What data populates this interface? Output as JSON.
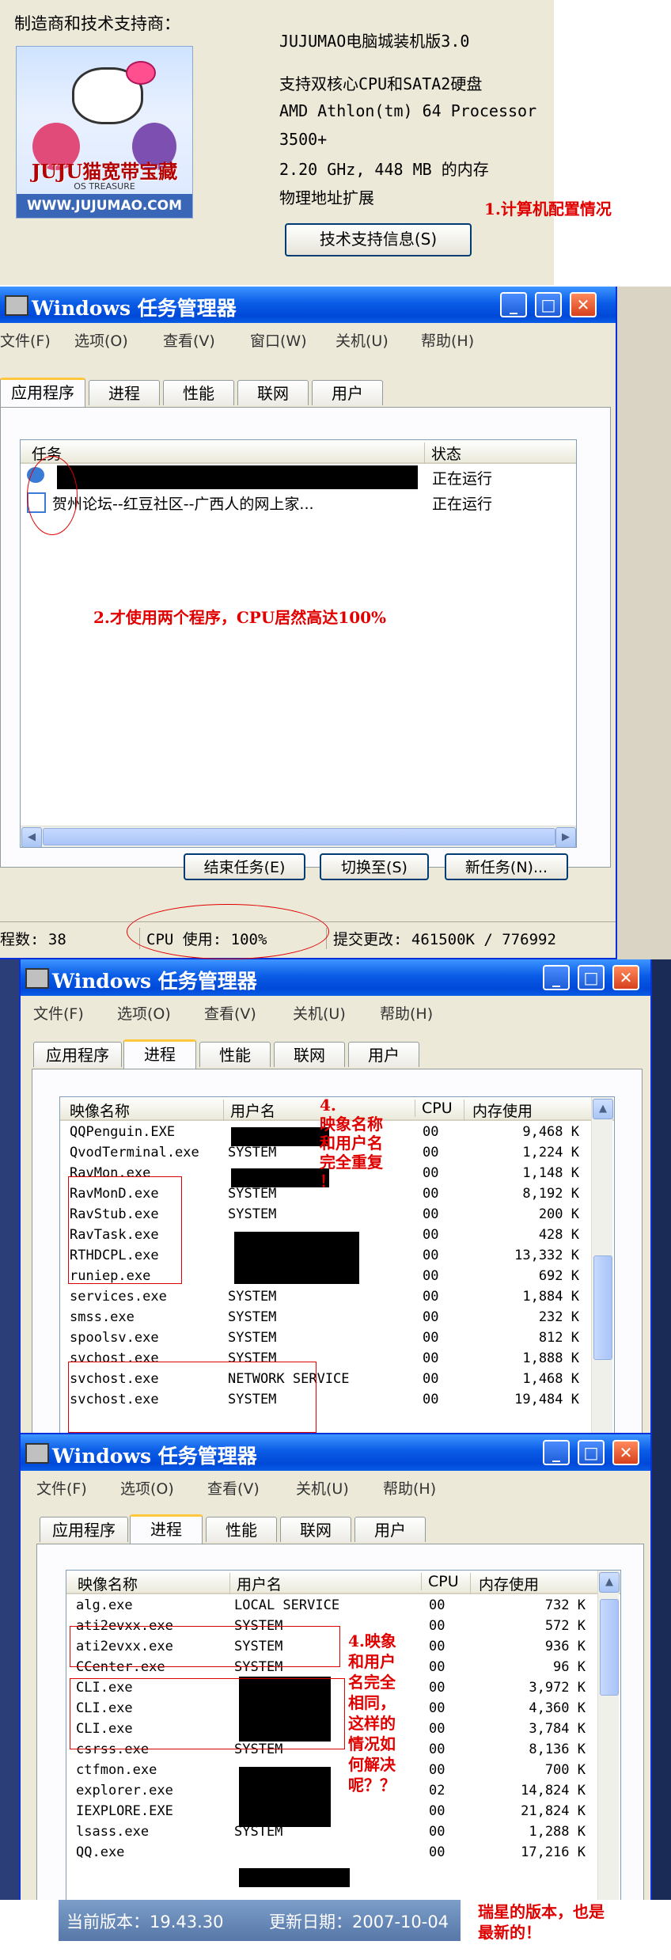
{
  "sysinfo": {
    "maker_label": "制造商和技术支持商：",
    "logo": {
      "brand": "JUJU猫宽带宝藏",
      "brand_sub": "OS TREASURE",
      "url": "WWW.JUJUMAO.COM"
    },
    "lines": [
      "JUJUMAO电脑城装机版3.0",
      "支持双核心CPU和SATA2硬盘",
      "AMD Athlon(tm) 64 Processor",
      "3500+",
      "2.20 GHz, 448 MB 的内存",
      "物理地址扩展"
    ],
    "tech_button": "技术支持信息(S)"
  },
  "notes": {
    "n1": "1.计算机配置情况",
    "n2": "2.才使用两个程序，CPU居然高达100%",
    "n4a": [
      "4.",
      "映象名称",
      "和用户名",
      "完全重复",
      "！"
    ],
    "n4b": [
      "4.映象",
      "和用户",
      "名完全",
      "相同，",
      "这样的",
      "情况如",
      "何解决",
      "呢？？"
    ],
    "n5": [
      "瑞星的版本，也是",
      "最新的！"
    ]
  },
  "taskmgr": {
    "title": "Windows 任务管理器",
    "menu1": [
      "文件(F)",
      "选项(O)",
      "查看(V)",
      "窗口(W)",
      "关机(U)",
      "帮助(H)"
    ],
    "menu2": [
      "文件(F)",
      "选项(O)",
      "查看(V)",
      "关机(U)",
      "帮助(H)"
    ],
    "tabs": [
      "应用程序",
      "进程",
      "性能",
      "联网",
      "用户"
    ],
    "app_cols": {
      "task": "任务",
      "status": "状态"
    },
    "apps": [
      {
        "name": "",
        "status": "正在运行"
      },
      {
        "name": "贺州论坛--红豆社区--广西人的网上家...",
        "status": "正在运行"
      }
    ],
    "buttons": [
      "结束任务(E)",
      "切换至(S)",
      "新任务(N)..."
    ],
    "status": {
      "procs": "程数: 38",
      "cpu": "CPU 使用: 100%",
      "commit": "提交更改: 461500K / 776992"
    },
    "proc_cols": {
      "image": "映像名称",
      "user": "用户名",
      "cpu": "CPU",
      "mem": "内存使用"
    },
    "procs1": [
      {
        "image": "QQPenguin.EXE",
        "user": "",
        "cpu": "00",
        "mem": "9,468 K"
      },
      {
        "image": "QvodTerminal.exe",
        "user": "SYSTEM",
        "cpu": "00",
        "mem": "1,224 K"
      },
      {
        "image": "RavMon.exe",
        "user": "",
        "cpu": "00",
        "mem": "1,148 K"
      },
      {
        "image": "RavMonD.exe",
        "user": "SYSTEM",
        "cpu": "00",
        "mem": "8,192 K"
      },
      {
        "image": "RavStub.exe",
        "user": "SYSTEM",
        "cpu": "00",
        "mem": "200 K"
      },
      {
        "image": "RavTask.exe",
        "user": "",
        "cpu": "00",
        "mem": "428 K"
      },
      {
        "image": "RTHDCPL.exe",
        "user": "",
        "cpu": "00",
        "mem": "13,332 K"
      },
      {
        "image": "runiep.exe",
        "user": "",
        "cpu": "00",
        "mem": "692 K"
      },
      {
        "image": "services.exe",
        "user": "SYSTEM",
        "cpu": "00",
        "mem": "1,884 K"
      },
      {
        "image": "smss.exe",
        "user": "SYSTEM",
        "cpu": "00",
        "mem": "232 K"
      },
      {
        "image": "spoolsv.exe",
        "user": "SYSTEM",
        "cpu": "00",
        "mem": "812 K"
      },
      {
        "image": "svchost.exe",
        "user": "SYSTEM",
        "cpu": "00",
        "mem": "1,888 K"
      },
      {
        "image": "svchost.exe",
        "user": "NETWORK SERVICE",
        "cpu": "00",
        "mem": "1,468 K"
      },
      {
        "image": "svchost.exe",
        "user": "SYSTEM",
        "cpu": "00",
        "mem": "19,484 K"
      }
    ],
    "procs2": [
      {
        "image": "alg.exe",
        "user": "LOCAL SERVICE",
        "cpu": "00",
        "mem": "732 K"
      },
      {
        "image": "ati2evxx.exe",
        "user": "SYSTEM",
        "cpu": "00",
        "mem": "572 K"
      },
      {
        "image": "ati2evxx.exe",
        "user": "SYSTEM",
        "cpu": "00",
        "mem": "936 K"
      },
      {
        "image": "CCenter.exe",
        "user": "SYSTEM",
        "cpu": "00",
        "mem": "96 K"
      },
      {
        "image": "CLI.exe",
        "user": "",
        "cpu": "00",
        "mem": "3,972 K"
      },
      {
        "image": "CLI.exe",
        "user": "",
        "cpu": "00",
        "mem": "4,360 K"
      },
      {
        "image": "CLI.exe",
        "user": "",
        "cpu": "00",
        "mem": "3,784 K"
      },
      {
        "image": "csrss.exe",
        "user": "SYSTEM",
        "cpu": "00",
        "mem": "8,136 K"
      },
      {
        "image": "ctfmon.exe",
        "user": "",
        "cpu": "00",
        "mem": "700 K"
      },
      {
        "image": "explorer.exe",
        "user": "",
        "cpu": "02",
        "mem": "14,824 K"
      },
      {
        "image": "IEXPLORE.EXE",
        "user": "",
        "cpu": "00",
        "mem": "21,824 K"
      },
      {
        "image": "lsass.exe",
        "user": "SYSTEM",
        "cpu": "00",
        "mem": "1,288 K"
      },
      {
        "image": "QQ.exe",
        "user": "",
        "cpu": "00",
        "mem": "17,216 K"
      }
    ]
  },
  "version": {
    "current": "当前版本：19.43.30",
    "updated": "更新日期：2007-10-04"
  },
  "colors": {
    "annotation": "#e00000",
    "titlebar": "#0a5ce6"
  }
}
